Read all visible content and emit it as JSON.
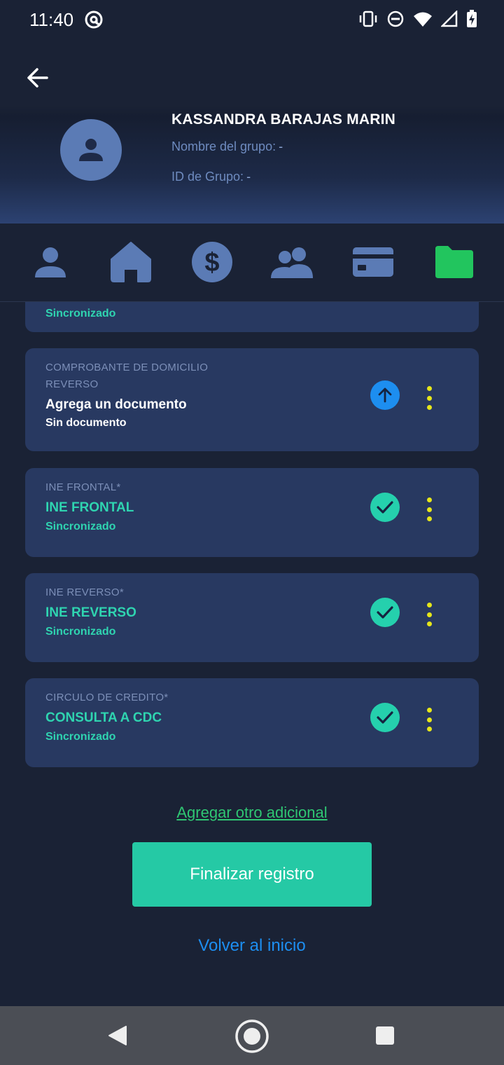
{
  "status_bar": {
    "time": "11:40",
    "icons": [
      "at-sign-icon",
      "vibrate-icon",
      "do-not-disturb-icon",
      "wifi-icon",
      "signal-icon",
      "battery-charging-icon"
    ]
  },
  "header": {
    "client_name": "KASSANDRA BARAJAS MARIN",
    "group_name_label": "Nombre del grupo:",
    "group_name_value": "-",
    "group_id_label": "ID de Grupo:",
    "group_id_value": "-"
  },
  "tabs": [
    {
      "name": "person-icon",
      "active": false
    },
    {
      "name": "home-icon",
      "active": false
    },
    {
      "name": "dollar-icon",
      "active": false
    },
    {
      "name": "group-icon",
      "active": false
    },
    {
      "name": "card-icon",
      "active": false
    },
    {
      "name": "folder-icon",
      "active": true
    }
  ],
  "documents": [
    {
      "title": "",
      "document": "",
      "status": "Sincronizado",
      "state": "done"
    },
    {
      "title": "COMPROBANTE DE DOMICILIO REVERSO",
      "title_line1": "COMPROBANTE DE DOMICILIO",
      "title_line2": "REVERSO",
      "document": "Agrega un documento",
      "status": "Sin documento",
      "state": "upload"
    },
    {
      "title": "INE FRONTAL*",
      "document": "INE FRONTAL",
      "status": "Sincronizado",
      "state": "done"
    },
    {
      "title": "INE REVERSO*",
      "document": "INE REVERSO",
      "status": "Sincronizado",
      "state": "done"
    },
    {
      "title": "CIRCULO DE CREDITO*",
      "document": "CONSULTA A CDC",
      "status": "Sincronizado",
      "state": "done"
    }
  ],
  "actions": {
    "add_additional": "Agregar otro adicional",
    "finish": "Finalizar registro",
    "back_home": "Volver al inicio"
  },
  "colors": {
    "background": "#1a2235",
    "card": "#283961",
    "teal": "#2fd4b0",
    "blue": "#1d8ef0",
    "green_link": "#2fc673",
    "kebab": "#e6e61a",
    "folder_active": "#22c55e",
    "tab_inactive": "#5b7bb5"
  }
}
